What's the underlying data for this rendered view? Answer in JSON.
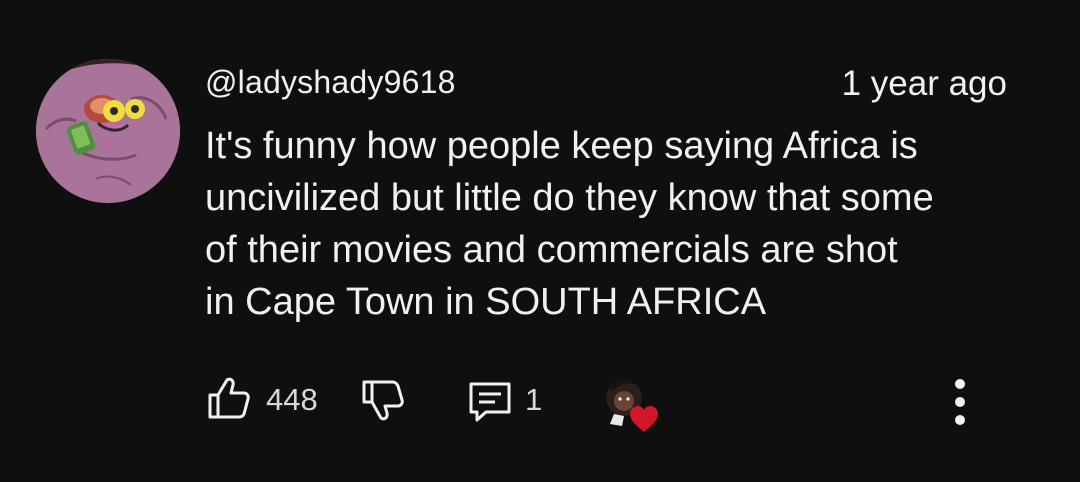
{
  "comment": {
    "author": "@ladyshady9618",
    "timestamp": "1 year ago",
    "text_lines": [
      "It's funny how people keep saying Africa is",
      "uncivilized but little do they know that some",
      "of their movies and commercials are shot",
      "in Cape Town in SOUTH AFRICA"
    ]
  },
  "actions": {
    "like_count": "448",
    "reply_count": "1",
    "icons": {
      "like": "thumbs-up-icon",
      "dislike": "thumbs-down-icon",
      "reply": "comment-reply-icon",
      "creator_heart": "creator-heart-badge",
      "more": "more-vertical-icon"
    }
  },
  "colors": {
    "background": "#0f0f0f",
    "text": "#f1f1f1",
    "heart": "#d2162a",
    "avatar_bg": "#a9749a"
  }
}
